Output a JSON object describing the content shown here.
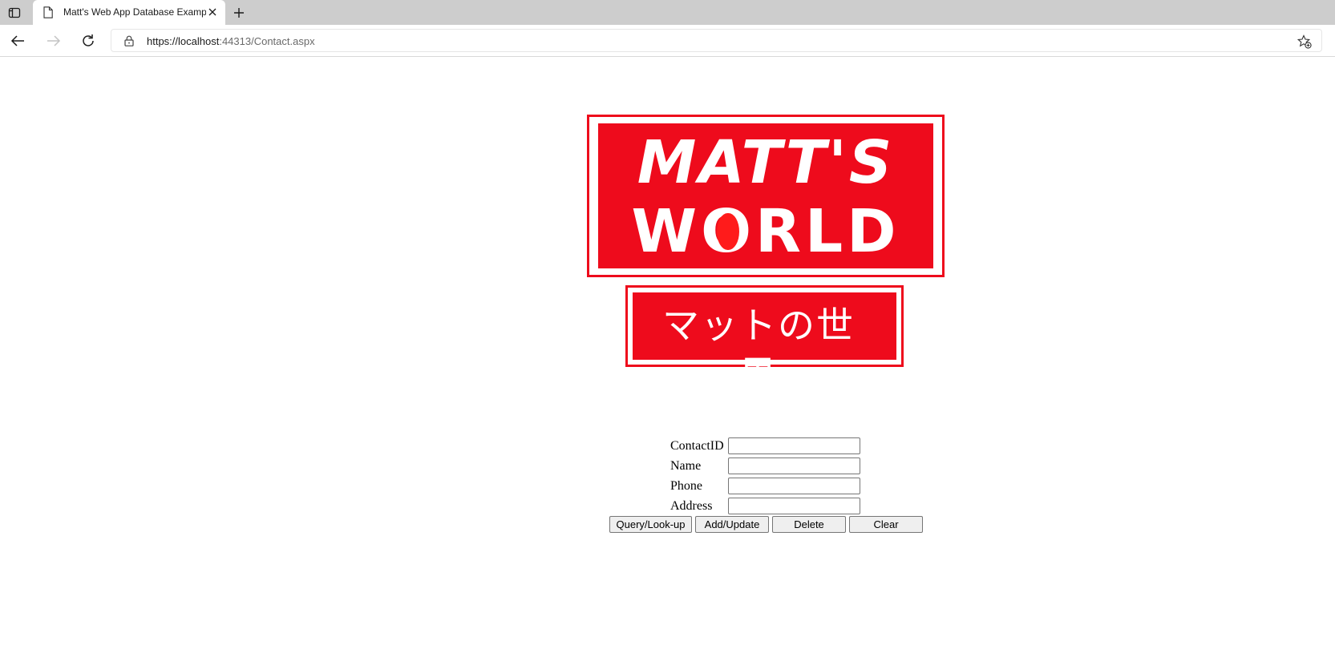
{
  "browser": {
    "tab": {
      "title": "Matt's Web App Database Examp"
    },
    "address": {
      "host": "https://localhost",
      "rest": ":44313/Contact.aspx"
    },
    "icons": {
      "tab_actions": "tab-actions-icon",
      "page": "page-icon",
      "close": "close-icon",
      "new_tab": "plus-icon",
      "back": "back-arrow-icon",
      "forward": "forward-arrow-icon",
      "refresh": "refresh-icon",
      "lock": "lock-icon",
      "favorite": "star-add-icon"
    }
  },
  "logo": {
    "line1": "MATT'S",
    "line2_pre": "W",
    "line2_o": "O",
    "line2_post": "RLD",
    "japanese": "マットの世界",
    "color": "#ee0b1c"
  },
  "form": {
    "fields": [
      {
        "label": "ContactID",
        "value": ""
      },
      {
        "label": "Name",
        "value": ""
      },
      {
        "label": "Phone",
        "value": ""
      },
      {
        "label": "Address",
        "value": ""
      }
    ],
    "buttons": {
      "query": "Query/Look-up",
      "add": "Add/Update",
      "delete": "Delete",
      "clear": "Clear"
    }
  }
}
